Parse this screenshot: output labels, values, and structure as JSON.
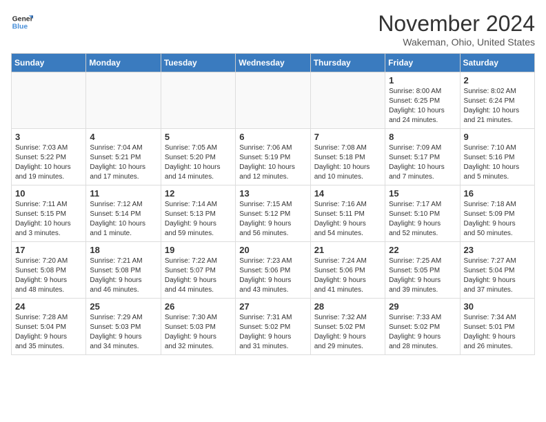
{
  "header": {
    "logo_line1": "General",
    "logo_line2": "Blue",
    "month": "November 2024",
    "location": "Wakeman, Ohio, United States"
  },
  "weekdays": [
    "Sunday",
    "Monday",
    "Tuesday",
    "Wednesday",
    "Thursday",
    "Friday",
    "Saturday"
  ],
  "weeks": [
    [
      {
        "day": "",
        "info": ""
      },
      {
        "day": "",
        "info": ""
      },
      {
        "day": "",
        "info": ""
      },
      {
        "day": "",
        "info": ""
      },
      {
        "day": "",
        "info": ""
      },
      {
        "day": "1",
        "info": "Sunrise: 8:00 AM\nSunset: 6:25 PM\nDaylight: 10 hours\nand 24 minutes."
      },
      {
        "day": "2",
        "info": "Sunrise: 8:02 AM\nSunset: 6:24 PM\nDaylight: 10 hours\nand 21 minutes."
      }
    ],
    [
      {
        "day": "3",
        "info": "Sunrise: 7:03 AM\nSunset: 5:22 PM\nDaylight: 10 hours\nand 19 minutes."
      },
      {
        "day": "4",
        "info": "Sunrise: 7:04 AM\nSunset: 5:21 PM\nDaylight: 10 hours\nand 17 minutes."
      },
      {
        "day": "5",
        "info": "Sunrise: 7:05 AM\nSunset: 5:20 PM\nDaylight: 10 hours\nand 14 minutes."
      },
      {
        "day": "6",
        "info": "Sunrise: 7:06 AM\nSunset: 5:19 PM\nDaylight: 10 hours\nand 12 minutes."
      },
      {
        "day": "7",
        "info": "Sunrise: 7:08 AM\nSunset: 5:18 PM\nDaylight: 10 hours\nand 10 minutes."
      },
      {
        "day": "8",
        "info": "Sunrise: 7:09 AM\nSunset: 5:17 PM\nDaylight: 10 hours\nand 7 minutes."
      },
      {
        "day": "9",
        "info": "Sunrise: 7:10 AM\nSunset: 5:16 PM\nDaylight: 10 hours\nand 5 minutes."
      }
    ],
    [
      {
        "day": "10",
        "info": "Sunrise: 7:11 AM\nSunset: 5:15 PM\nDaylight: 10 hours\nand 3 minutes."
      },
      {
        "day": "11",
        "info": "Sunrise: 7:12 AM\nSunset: 5:14 PM\nDaylight: 10 hours\nand 1 minute."
      },
      {
        "day": "12",
        "info": "Sunrise: 7:14 AM\nSunset: 5:13 PM\nDaylight: 9 hours\nand 59 minutes."
      },
      {
        "day": "13",
        "info": "Sunrise: 7:15 AM\nSunset: 5:12 PM\nDaylight: 9 hours\nand 56 minutes."
      },
      {
        "day": "14",
        "info": "Sunrise: 7:16 AM\nSunset: 5:11 PM\nDaylight: 9 hours\nand 54 minutes."
      },
      {
        "day": "15",
        "info": "Sunrise: 7:17 AM\nSunset: 5:10 PM\nDaylight: 9 hours\nand 52 minutes."
      },
      {
        "day": "16",
        "info": "Sunrise: 7:18 AM\nSunset: 5:09 PM\nDaylight: 9 hours\nand 50 minutes."
      }
    ],
    [
      {
        "day": "17",
        "info": "Sunrise: 7:20 AM\nSunset: 5:08 PM\nDaylight: 9 hours\nand 48 minutes."
      },
      {
        "day": "18",
        "info": "Sunrise: 7:21 AM\nSunset: 5:08 PM\nDaylight: 9 hours\nand 46 minutes."
      },
      {
        "day": "19",
        "info": "Sunrise: 7:22 AM\nSunset: 5:07 PM\nDaylight: 9 hours\nand 44 minutes."
      },
      {
        "day": "20",
        "info": "Sunrise: 7:23 AM\nSunset: 5:06 PM\nDaylight: 9 hours\nand 43 minutes."
      },
      {
        "day": "21",
        "info": "Sunrise: 7:24 AM\nSunset: 5:06 PM\nDaylight: 9 hours\nand 41 minutes."
      },
      {
        "day": "22",
        "info": "Sunrise: 7:25 AM\nSunset: 5:05 PM\nDaylight: 9 hours\nand 39 minutes."
      },
      {
        "day": "23",
        "info": "Sunrise: 7:27 AM\nSunset: 5:04 PM\nDaylight: 9 hours\nand 37 minutes."
      }
    ],
    [
      {
        "day": "24",
        "info": "Sunrise: 7:28 AM\nSunset: 5:04 PM\nDaylight: 9 hours\nand 35 minutes."
      },
      {
        "day": "25",
        "info": "Sunrise: 7:29 AM\nSunset: 5:03 PM\nDaylight: 9 hours\nand 34 minutes."
      },
      {
        "day": "26",
        "info": "Sunrise: 7:30 AM\nSunset: 5:03 PM\nDaylight: 9 hours\nand 32 minutes."
      },
      {
        "day": "27",
        "info": "Sunrise: 7:31 AM\nSunset: 5:02 PM\nDaylight: 9 hours\nand 31 minutes."
      },
      {
        "day": "28",
        "info": "Sunrise: 7:32 AM\nSunset: 5:02 PM\nDaylight: 9 hours\nand 29 minutes."
      },
      {
        "day": "29",
        "info": "Sunrise: 7:33 AM\nSunset: 5:02 PM\nDaylight: 9 hours\nand 28 minutes."
      },
      {
        "day": "30",
        "info": "Sunrise: 7:34 AM\nSunset: 5:01 PM\nDaylight: 9 hours\nand 26 minutes."
      }
    ]
  ]
}
